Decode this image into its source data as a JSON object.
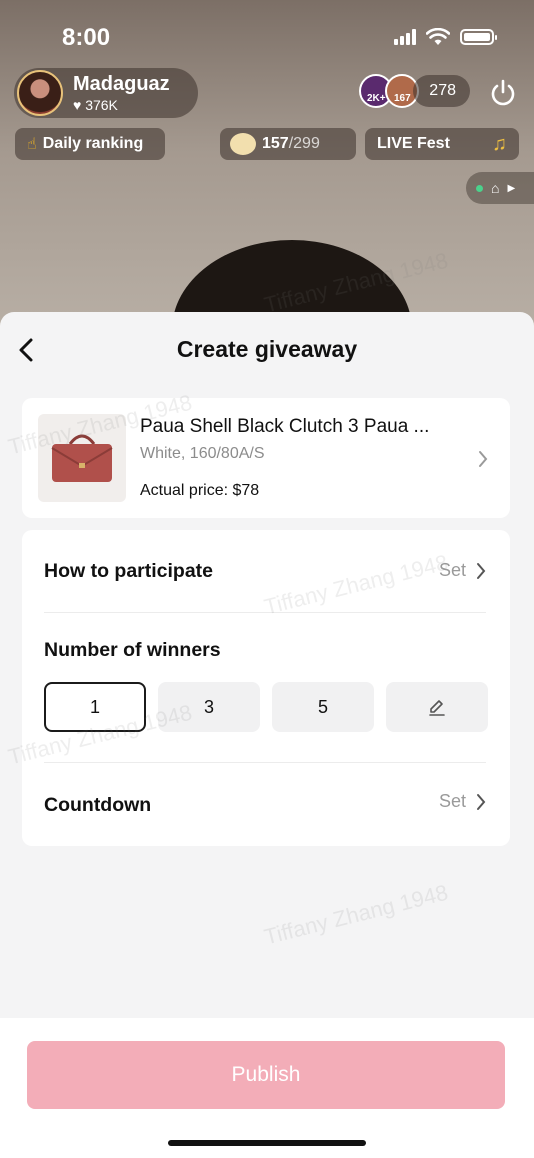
{
  "status_bar": {
    "time": "8:00"
  },
  "live": {
    "host_name": "Madaguaz",
    "host_likes": "376K",
    "viewer_badges": [
      "2K+",
      "167"
    ],
    "viewer_count": "278",
    "daily_ranking": "Daily ranking",
    "progress_current": "157",
    "progress_total": "/299",
    "live_fest": "LIVE Fest"
  },
  "sheet": {
    "title": "Create giveaway",
    "product": {
      "name": "Paua Shell Black Clutch 3 Paua ...",
      "variant": "White, 160/80A/S",
      "price": "Actual price: $78"
    },
    "participate": {
      "label": "How to participate",
      "value": "Set"
    },
    "winners": {
      "label": "Number of winners",
      "options": [
        "1",
        "3",
        "5"
      ],
      "selected": "1"
    },
    "countdown": {
      "label": "Countdown",
      "value": "Set"
    },
    "publish_label": "Publish"
  },
  "watermark": {
    "text": "Tiffany Zhang 1948"
  },
  "colors": {
    "publish_disabled": "#f3adb8",
    "sheet_bg": "#f4f4f5"
  }
}
